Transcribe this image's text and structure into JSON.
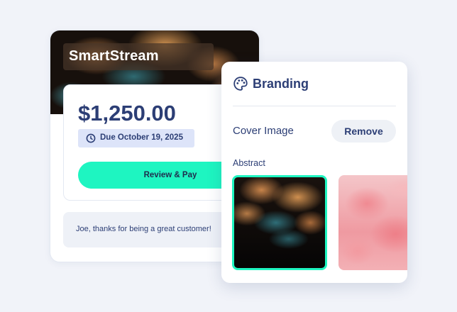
{
  "invoice": {
    "brand_name": "SmartStream",
    "amount": "$1,250.00",
    "due_date": "Due October 19, 2025",
    "pay_button": "Review & Pay",
    "note": "Joe, thanks for being a great customer!"
  },
  "branding_panel": {
    "title": "Branding",
    "cover_image_label": "Cover Image",
    "remove_button": "Remove",
    "section_label": "Abstract",
    "thumbnails": [
      {
        "name": "abstract-smoke-orange-teal",
        "selected": true
      },
      {
        "name": "abstract-smoke-pink",
        "selected": false
      }
    ]
  },
  "colors": {
    "accent": "#1ef5c1",
    "text_primary": "#2c3e75",
    "badge_bg": "#dde4f9",
    "background": "#f1f3f9"
  },
  "icons": [
    "clock-icon",
    "palette-icon"
  ]
}
